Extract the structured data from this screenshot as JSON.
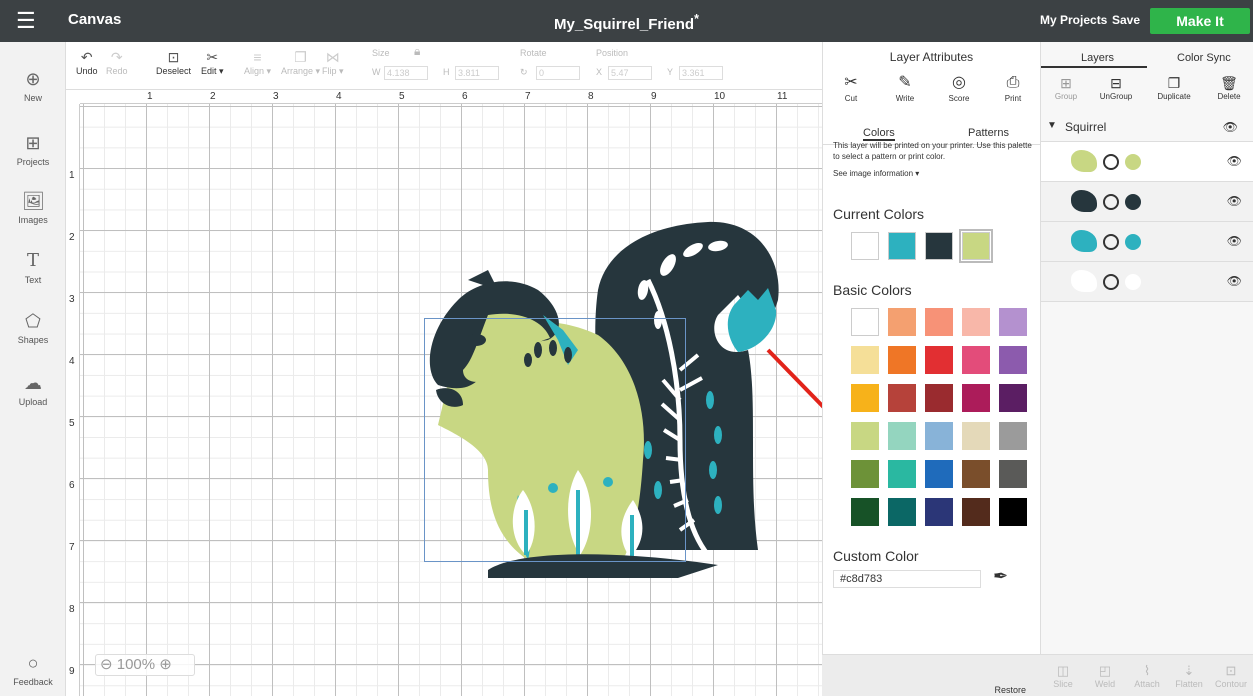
{
  "header": {
    "app_name": "Canvas",
    "project_name": "My_Squirrel_Friend",
    "unsaved_mark": "*",
    "my_projects": "My Projects",
    "save": "Save",
    "make_it": "Make It"
  },
  "sidebar": {
    "items": [
      {
        "label": "New",
        "icon": "plus-circle-icon"
      },
      {
        "label": "Projects",
        "icon": "projects-icon"
      },
      {
        "label": "Images",
        "icon": "image-icon"
      },
      {
        "label": "Text",
        "icon": "text-icon"
      },
      {
        "label": "Shapes",
        "icon": "shapes-icon"
      },
      {
        "label": "Upload",
        "icon": "upload-icon"
      },
      {
        "label": "Feedback",
        "icon": "chat-icon"
      }
    ]
  },
  "toolbar": {
    "undo": "Undo",
    "redo": "Redo",
    "deselect": "Deselect",
    "edit": "Edit ▾",
    "align": "Align ▾",
    "arrange": "Arrange ▾",
    "flip": "Flip ▾",
    "size_label": "Size",
    "w_label": "W",
    "w_value": "4.138",
    "h_label": "H",
    "h_value": "3.811",
    "rotate_label": "Rotate",
    "rotate_value": "0",
    "position_label": "Position",
    "x_label": "X",
    "x_value": "5.47",
    "y_label": "Y",
    "y_value": "3.361"
  },
  "ruler": {
    "top": [
      "1",
      "2",
      "3",
      "4",
      "5",
      "6",
      "7",
      "8",
      "9",
      "10",
      "11"
    ],
    "left": [
      "1",
      "2",
      "3",
      "4",
      "5",
      "6",
      "7",
      "8",
      "9"
    ]
  },
  "zoom": {
    "label": "100%"
  },
  "attributes": {
    "title": "Layer Attributes",
    "ops": [
      "Cut",
      "Write",
      "Score",
      "Print"
    ],
    "active_op": "Print",
    "tabs": [
      "Colors",
      "Patterns"
    ],
    "active_tab": "Colors",
    "description": "This layer will be printed on your printer. Use this palette to select a pattern or print color.",
    "info_link": "See image information ▾",
    "current_colors_title": "Current Colors",
    "current_colors": [
      "#ffffff",
      "#2db1bf",
      "#26363d",
      "#c8d783"
    ],
    "selected_current": "#c8d783",
    "basic_colors_title": "Basic Colors",
    "basic_colors": [
      "#ffffff",
      "#f4a070",
      "#f79277",
      "#f8b7a9",
      "#b491cf",
      "#f5df98",
      "#ef7626",
      "#e22f32",
      "#e34c7a",
      "#8c5bad",
      "#f7b21a",
      "#b6423a",
      "#9a2b2f",
      "#ac1c5a",
      "#5b1e63",
      "#c8d783",
      "#94d5bf",
      "#88b3d8",
      "#e4d9b9",
      "#9b9b9b",
      "#6d9238",
      "#2ab8a1",
      "#1f6bbb",
      "#7a4e2b",
      "#5a5a58",
      "#175227",
      "#0b6765",
      "#2b3677",
      "#532b1c",
      "#000000"
    ],
    "custom_color_title": "Custom Color",
    "custom_color_value": "#c8d783",
    "restore": "Restore"
  },
  "layers": {
    "tabs": [
      "Layers",
      "Color Sync"
    ],
    "ops": [
      "Group",
      "UnGroup",
      "Duplicate",
      "Delete"
    ],
    "group_name": "Squirrel",
    "rows": [
      {
        "color": "#c8d783",
        "art": "#c8d783"
      },
      {
        "color": "#26363d",
        "art": "#26363d"
      },
      {
        "color": "#2db1bf",
        "art": "#2db1bf"
      },
      {
        "color": "#ffffff",
        "art": "#ffffff"
      }
    ],
    "footer": [
      "Slice",
      "Weld",
      "Attach",
      "Flatten",
      "Contour"
    ]
  },
  "colors": {
    "topbar": "#3c4144",
    "accent": "#2fb44a",
    "arrow": "#e2231a"
  }
}
